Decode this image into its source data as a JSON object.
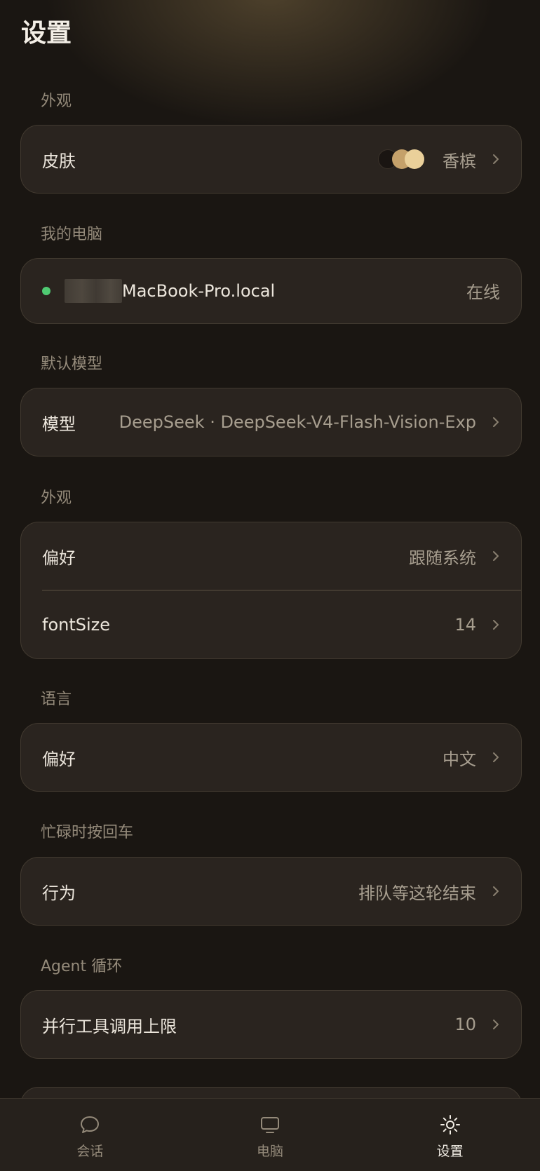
{
  "header": {
    "title": "设置"
  },
  "sections": {
    "appearance_skin": {
      "label": "外观",
      "skin_label": "皮肤",
      "skin_value": "香槟",
      "swatch_colors": [
        "#1a1512",
        "#c5a16a",
        "#ead09a"
      ]
    },
    "my_computer": {
      "label": "我的电脑",
      "host_suffix": "MacBook-Pro.local",
      "status": "在线",
      "status_color": "#4fca72"
    },
    "default_model": {
      "label": "默认模型",
      "model_label": "模型",
      "model_value": "DeepSeek · DeepSeek-V4-Flash-Vision-Exp"
    },
    "appearance_prefs": {
      "label": "外观",
      "pref_label": "偏好",
      "pref_value": "跟随系统",
      "font_label": "fontSize",
      "font_value": "14"
    },
    "language": {
      "label": "语言",
      "pref_label": "偏好",
      "pref_value": "中文"
    },
    "busy_enter": {
      "label": "忙碌时按回车",
      "behavior_label": "行为",
      "behavior_value": "排队等这轮结束"
    },
    "agent_loop": {
      "label": "Agent 循环",
      "parallel_label": "并行工具调用上限",
      "parallel_value": "10"
    }
  },
  "tabbar": {
    "tabs": [
      {
        "label": "会话",
        "icon": "chat-bubble-icon"
      },
      {
        "label": "电脑",
        "icon": "monitor-icon"
      },
      {
        "label": "设置",
        "icon": "gear-icon",
        "active": true
      }
    ]
  },
  "colors": {
    "background": "#1a1612",
    "card": "#2a241f",
    "card_border": "#423a30",
    "muted_text": "#948a7a"
  }
}
